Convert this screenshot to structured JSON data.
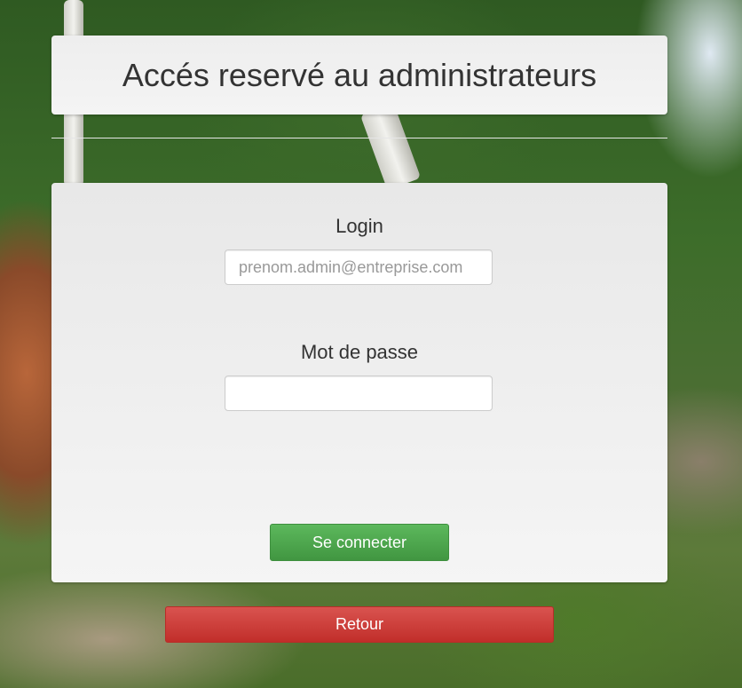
{
  "header": {
    "title": "Accés reservé au administrateurs"
  },
  "form": {
    "login_label": "Login",
    "login_placeholder": "prenom.admin@entreprise.com",
    "login_value": "",
    "password_label": "Mot de passe",
    "password_value": "",
    "submit_label": "Se connecter"
  },
  "back_button": {
    "label": "Retour"
  },
  "colors": {
    "submit_button": "#5cb85c",
    "back_button": "#d9534f",
    "card_background": "#f0f0f0",
    "text": "#333333"
  }
}
